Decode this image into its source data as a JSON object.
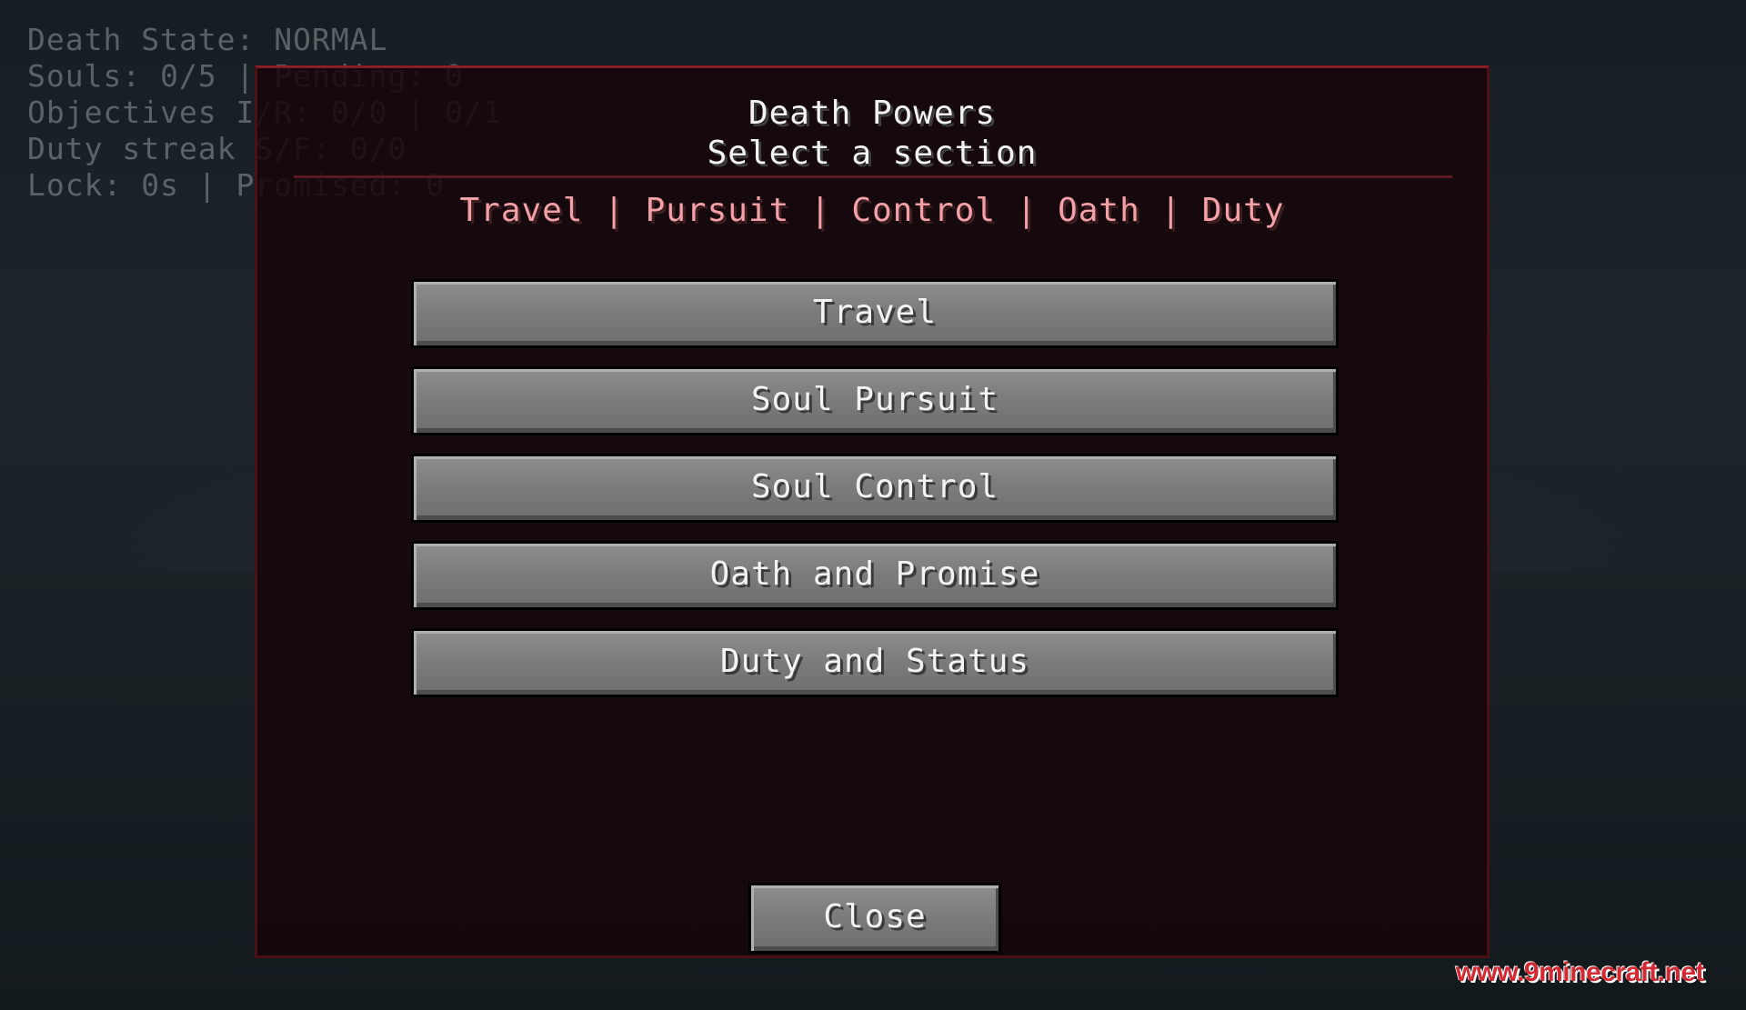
{
  "hud": {
    "lines": [
      "Death State: NORMAL",
      "Souls: 0/5 | Pending: 0",
      "Objectives I/R: 0/0 | 0/1",
      "Duty streak S/F: 0/0",
      "Lock: 0s | Promised: 0"
    ]
  },
  "panel": {
    "title": "Death Powers",
    "subtitle": "Select a section",
    "nav": {
      "items": [
        "Travel",
        "Pursuit",
        "Control",
        "Oath",
        "Duty"
      ],
      "separator": " | "
    },
    "buttons": [
      {
        "label": "Travel"
      },
      {
        "label": "Soul Pursuit"
      },
      {
        "label": "Soul Control"
      },
      {
        "label": "Oath and Promise"
      },
      {
        "label": "Duty and Status"
      }
    ],
    "close_label": "Close"
  },
  "watermark": "www.9minecraft.net",
  "colors": {
    "panel_border": "#8a1c26",
    "nav_text": "#f3a0a6",
    "button_gray": "#7b7b7b",
    "watermark_red": "#d12a33"
  }
}
